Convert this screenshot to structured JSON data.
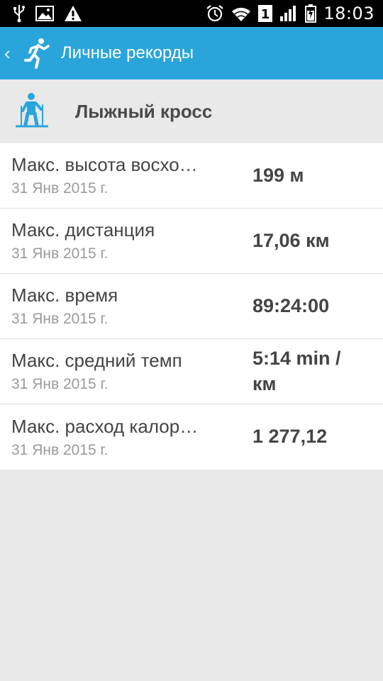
{
  "status_bar": {
    "icons_left": [
      "usb-icon",
      "image-icon",
      "warning-icon"
    ],
    "icons_right": [
      "alarm-icon",
      "wifi-icon",
      "sim-1-icon",
      "signal-icon",
      "battery-icon"
    ],
    "sim_number": "1",
    "time": "18:03"
  },
  "app_bar": {
    "title": "Личные рекорды",
    "background": "#2aa5dc"
  },
  "section": {
    "title": "Лыжный кросс",
    "icon": "skiing-icon",
    "icon_color": "#2aa5dc"
  },
  "records": [
    {
      "label": "Макс. высота восхо…",
      "date": "31 Янв 2015 г.",
      "value": "199 м"
    },
    {
      "label": "Макс. дистанция",
      "date": "31 Янв 2015 г.",
      "value": "17,06 км"
    },
    {
      "label": "Макс. время",
      "date": "31 Янв 2015 г.",
      "value": "89:24:00"
    },
    {
      "label": "Макс. средний темп",
      "date": "31 Янв 2015 г.",
      "value": "5:14 min / км"
    },
    {
      "label": "Макс. расход калор…",
      "date": "31 Янв 2015 г.",
      "value": "1 277,12"
    }
  ]
}
